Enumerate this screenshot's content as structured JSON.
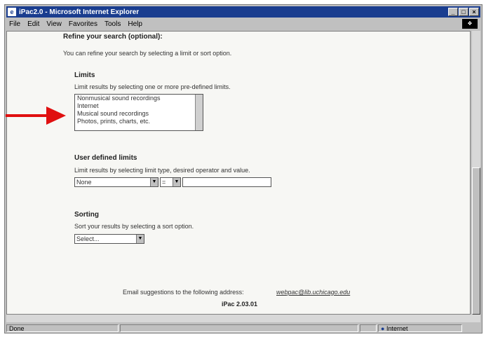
{
  "window": {
    "title": "iPac2.0 - Microsoft Internet Explorer",
    "menus": [
      "File",
      "Edit",
      "View",
      "Favorites",
      "Tools",
      "Help"
    ]
  },
  "page": {
    "section_heading": "Refine your search (optional):",
    "intro": "You can refine your search by selecting a limit or sort option.",
    "limits": {
      "heading": "Limits",
      "desc": "Limit results by selecting one or more pre-defined limits.",
      "options": [
        "Nonmusical sound recordings",
        "Internet",
        "Musical sound recordings",
        "Photos, prints, charts, etc."
      ]
    },
    "user_limits": {
      "heading": "User defined limits",
      "desc": "Limit results by selecting limit type, desired operator and value.",
      "type_value": "None",
      "operator_value": "="
    },
    "sorting": {
      "heading": "Sorting",
      "desc": "Sort your results by selecting a sort option.",
      "select_value": "Select..."
    },
    "footer": {
      "email_text": "Email suggestions to the following address:",
      "email_link": "webpac@lib.uchicago.edu",
      "version": "iPac 2.03.01"
    }
  },
  "status": {
    "text": "Done",
    "zone": "Internet"
  },
  "colors": {
    "arrow": "#e01010",
    "titlebar": "#1a3d8f"
  },
  "icons": [
    "ie-page-icon",
    "minimize-icon",
    "maximize-icon",
    "close-icon",
    "windows-logo-icon",
    "red-arrow-icon",
    "internet-zone-icon"
  ]
}
